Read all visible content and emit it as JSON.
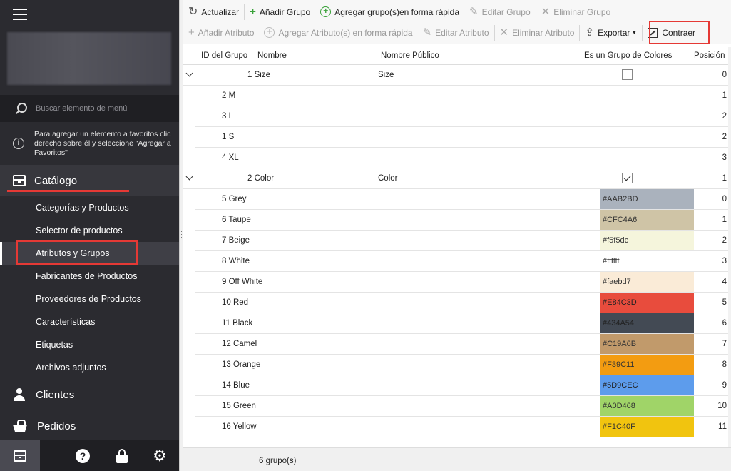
{
  "sidebar": {
    "search_placeholder": "Buscar elemento de menú",
    "favorites_tip": "Para agregar un elemento a favoritos clic derecho sobre él y seleccione \"Agregar a Favoritos\"",
    "catalog_label": "Catálogo",
    "submenu": [
      {
        "label": "Categorías y Productos"
      },
      {
        "label": "Selector de productos"
      },
      {
        "label": "Atributos y Grupos"
      },
      {
        "label": "Fabricantes de Productos"
      },
      {
        "label": "Proveedores de Productos"
      },
      {
        "label": "Características"
      },
      {
        "label": "Etiquetas"
      },
      {
        "label": "Archivos adjuntos"
      }
    ],
    "clients_label": "Clientes",
    "orders_label": "Pedidos",
    "help_glyph": "?",
    "gear_glyph": "⚙"
  },
  "toolbar": {
    "refresh": "Actualizar",
    "add_group": "Añadir Grupo",
    "quick_add_groups": "Agregar grupo(s)en forma rápida",
    "edit_group": "Editar Grupo",
    "delete_group": "Eliminar Grupo",
    "add_attribute": "Añadir Atributo",
    "quick_add_attributes": "Agregar Atributo(s) en forma rápida",
    "edit_attribute": "Editar Atributo",
    "delete_attribute": "Eliminar Atributo",
    "export": "Exportar",
    "collapse": "Contraer"
  },
  "grid": {
    "columns": {
      "id": "ID del Grupo",
      "name": "Nombre",
      "public_name": "Nombre Público",
      "is_color": "Es un Grupo de Colores",
      "position": "Posición"
    },
    "groups": [
      {
        "label": "1 Size",
        "public_name": "Size",
        "is_color": false,
        "position": "0",
        "attributes": [
          {
            "label": "2 M",
            "position": "1"
          },
          {
            "label": "3 L",
            "position": "2"
          },
          {
            "label": "1 S",
            "position": "2"
          },
          {
            "label": "4 XL",
            "position": "3"
          }
        ]
      },
      {
        "label": "2 Color",
        "public_name": "Color",
        "is_color": true,
        "position": "1",
        "attributes": [
          {
            "label": "5 Grey",
            "color": "#AAB2BD",
            "color_text": "#AAB2BD",
            "position": "0"
          },
          {
            "label": "6 Taupe",
            "color": "#CFC4A6",
            "color_text": "#CFC4A6",
            "position": "1"
          },
          {
            "label": "7 Beige",
            "color": "#f5f5dc",
            "color_text": "#f5f5dc",
            "position": "2"
          },
          {
            "label": "8 White",
            "color": "#ffffff",
            "color_text": "#ffffff",
            "position": "3"
          },
          {
            "label": "9 Off White",
            "color": "#faebd7",
            "color_text": "#faebd7",
            "position": "4"
          },
          {
            "label": "10 Red",
            "color": "#E84C3D",
            "color_text": "#E84C3D",
            "position": "5"
          },
          {
            "label": "11 Black",
            "color": "#434A54",
            "color_text": "#434A54",
            "position": "6"
          },
          {
            "label": "12 Camel",
            "color": "#C19A6B",
            "color_text": "#C19A6B",
            "position": "7"
          },
          {
            "label": "13 Orange",
            "color": "#F39C11",
            "color_text": "#F39C11",
            "position": "8"
          },
          {
            "label": "14 Blue",
            "color": "#5D9CEC",
            "color_text": "#5D9CEC",
            "position": "9"
          },
          {
            "label": "15 Green",
            "color": "#A0D468",
            "color_text": "#A0D468",
            "position": "10"
          },
          {
            "label": "16 Yellow",
            "color": "#F1C40F",
            "color_text": "#F1C40F",
            "position": "11"
          }
        ]
      }
    ]
  },
  "status": {
    "count": "6 grupo(s)"
  }
}
